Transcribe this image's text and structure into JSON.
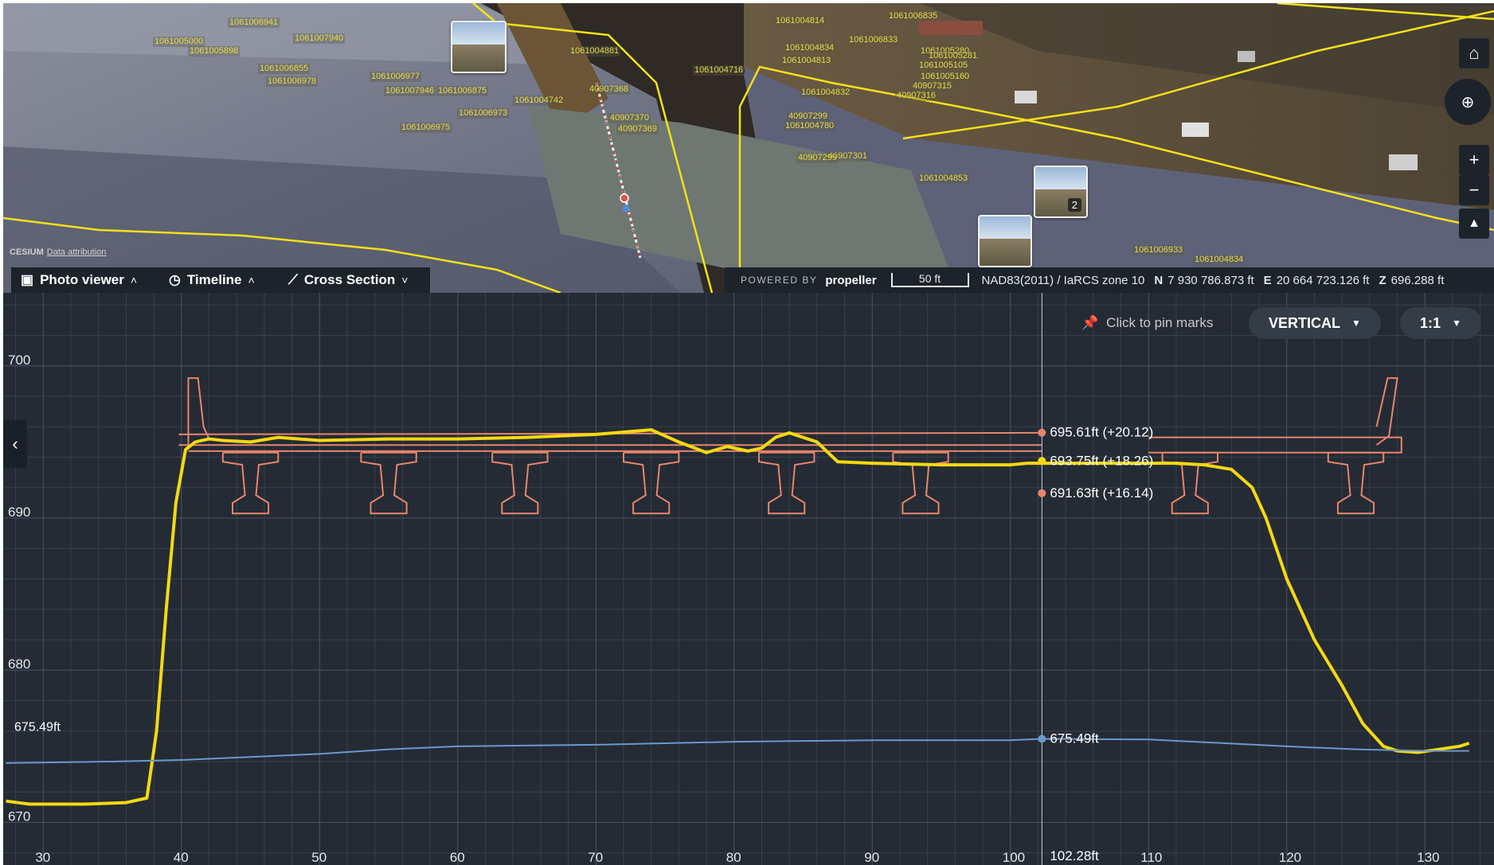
{
  "map": {
    "labels": [
      "1061006941",
      "1061005000",
      "1061005898",
      "1061007940",
      "1061006855",
      "1061006977",
      "1061006978",
      "1061007946",
      "1061006973",
      "1061006875",
      "1061006975",
      "1061004881",
      "40907368",
      "1061004742",
      "40907370",
      "40907369",
      "1061004716",
      "1061004814",
      "1061004813",
      "1061006833",
      "1061006835",
      "1061004834",
      "1061005105",
      "1061005280",
      "40907315",
      "40907316",
      "40907299",
      "1061004780",
      "40907301",
      "40907299",
      "1061004853",
      "1061006933",
      "1061004834",
      "1061005160",
      "1061005281",
      "1061004832"
    ],
    "photo_badge_count": "2",
    "cesium": "CESIUM",
    "data_attribution": "Data attribution",
    "controls": {
      "home": "⌂",
      "globe": "⊕",
      "zoom_in": "+",
      "zoom_out": "−",
      "terrain": "▲"
    }
  },
  "toolbar": {
    "photo_viewer": "Photo viewer",
    "timeline": "Timeline",
    "cross_section": "Cross Section",
    "powered_by": "POWERED BY",
    "brand": "propeller",
    "scale": "50 ft",
    "crs": "NAD83(2011) / IaRCS zone 10",
    "n_label": "N",
    "n_value": "7 930 786.873 ft",
    "e_label": "E",
    "e_value": "20 664 723.126 ft",
    "z_label": "Z",
    "z_value": "696.288 ft"
  },
  "controls": {
    "pin_marks": "Click to pin marks",
    "mode": "VERTICAL",
    "ratio": "1:1"
  },
  "chart_data": {
    "type": "line",
    "x_ticks": [
      30,
      40,
      50,
      60,
      70,
      80,
      90,
      100,
      110,
      120,
      130
    ],
    "y_ticks": [
      670,
      680,
      690,
      700
    ],
    "xlim": [
      27.1,
      135.0
    ],
    "ylim": [
      667.2,
      704.8
    ],
    "grid": true,
    "cursor": {
      "x": 102.28,
      "label": "102.28ft"
    },
    "left_label": "675.49ft",
    "series": [
      {
        "color": "#f5d90f",
        "points": [
          [
            27.3,
            671.4
          ],
          [
            29,
            671.2
          ],
          [
            33,
            671.2
          ],
          [
            36,
            671.3
          ],
          [
            37.5,
            671.6
          ],
          [
            38.2,
            676
          ],
          [
            38.9,
            684
          ],
          [
            39.6,
            691
          ],
          [
            40.3,
            694.5
          ],
          [
            41,
            695
          ],
          [
            42,
            695.2
          ],
          [
            43,
            695.1
          ],
          [
            45,
            695
          ],
          [
            47,
            695.3
          ],
          [
            50,
            695.1
          ],
          [
            55,
            695.2
          ],
          [
            60,
            695.2
          ],
          [
            65,
            695.3
          ],
          [
            70,
            695.5
          ],
          [
            74,
            695.8
          ],
          [
            76,
            695
          ],
          [
            78,
            694.3
          ],
          [
            79.5,
            694.7
          ],
          [
            81,
            694.4
          ],
          [
            82,
            694.6
          ],
          [
            83,
            695.3
          ],
          [
            84,
            695.6
          ],
          [
            86,
            695
          ],
          [
            87.5,
            693.7
          ],
          [
            90,
            693.6
          ],
          [
            95,
            693.5
          ],
          [
            100,
            693.5
          ],
          [
            101.2,
            693.6
          ],
          [
            110,
            693.6
          ],
          [
            112,
            693.6
          ],
          [
            114,
            693.5
          ],
          [
            116,
            693.2
          ],
          [
            117.5,
            692
          ],
          [
            118.5,
            690
          ],
          [
            120,
            686
          ],
          [
            122,
            682
          ],
          [
            124,
            679
          ],
          [
            125.5,
            676.5
          ],
          [
            127,
            675
          ],
          [
            128,
            674.7
          ],
          [
            129.5,
            674.6
          ],
          [
            131,
            674.8
          ],
          [
            132.5,
            675
          ],
          [
            133.2,
            675.2
          ]
        ]
      },
      {
        "color": "#6d98c8",
        "points": [
          [
            27.3,
            673.9
          ],
          [
            35,
            674
          ],
          [
            40,
            674.1
          ],
          [
            45,
            674.3
          ],
          [
            50,
            674.5
          ],
          [
            55,
            674.8
          ],
          [
            60,
            675
          ],
          [
            70,
            675.1
          ],
          [
            80,
            675.3
          ],
          [
            90,
            675.4
          ],
          [
            100,
            675.4
          ],
          [
            102.28,
            675.49
          ],
          [
            110,
            675.45
          ],
          [
            120,
            675
          ],
          [
            125,
            674.8
          ],
          [
            130,
            674.7
          ],
          [
            133.2,
            674.7
          ]
        ]
      }
    ],
    "markers": [
      {
        "x": 102.28,
        "y": 695.61,
        "label": "695.61ft (+20.12)",
        "color": "#e8856c"
      },
      {
        "x": 102.28,
        "y": 693.75,
        "label": "693.75ft (+18.26)",
        "color": "#f5d90f"
      },
      {
        "x": 102.28,
        "y": 691.63,
        "label": "691.63ft (+16.14)",
        "color": "#e8856c"
      },
      {
        "x": 102.28,
        "y": 675.49,
        "label": "675.49ft",
        "color": "#6d98c8"
      }
    ]
  }
}
